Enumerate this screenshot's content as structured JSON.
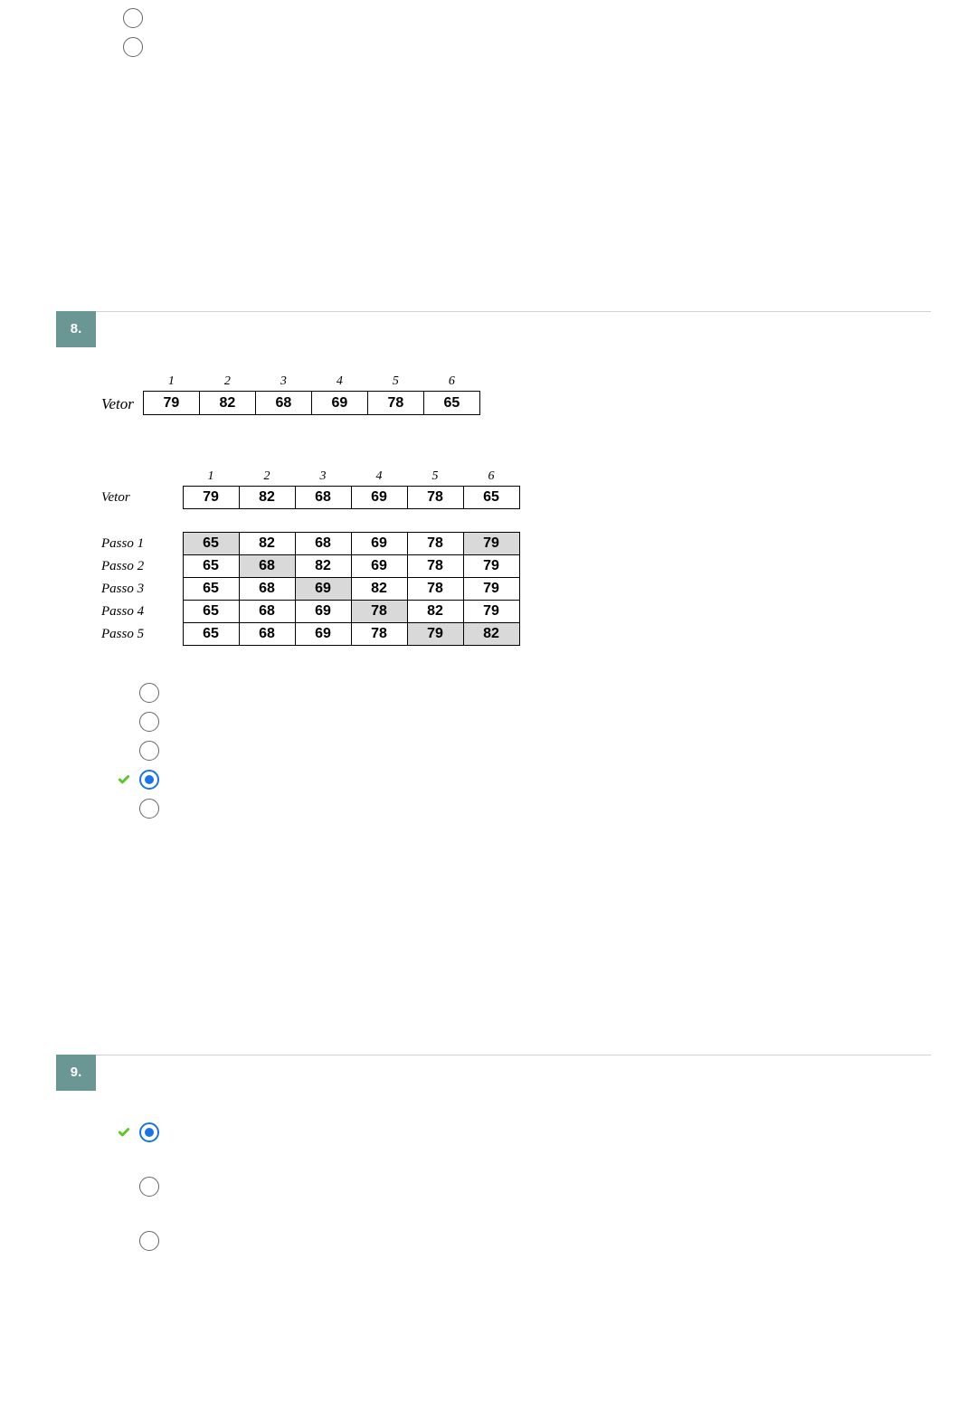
{
  "pre_options_count": 2,
  "q8": {
    "number": "8.",
    "vetor_label": "Vetor",
    "indices": [
      "1",
      "2",
      "3",
      "4",
      "5",
      "6"
    ],
    "vetor_values": [
      "79",
      "82",
      "68",
      "69",
      "78",
      "65"
    ],
    "steps_vetor_label": "Vetor",
    "steps_vetor_values": [
      "79",
      "82",
      "68",
      "69",
      "78",
      "65"
    ],
    "step_rows": [
      {
        "label": "Passo 1",
        "cells": [
          "65",
          "82",
          "68",
          "69",
          "78",
          "79"
        ],
        "hl": [
          0,
          5
        ]
      },
      {
        "label": "Passo 2",
        "cells": [
          "65",
          "68",
          "82",
          "69",
          "78",
          "79"
        ],
        "hl": [
          1
        ]
      },
      {
        "label": "Passo 3",
        "cells": [
          "65",
          "68",
          "69",
          "82",
          "78",
          "79"
        ],
        "hl": [
          2
        ]
      },
      {
        "label": "Passo 4",
        "cells": [
          "65",
          "68",
          "69",
          "78",
          "82",
          "79"
        ],
        "hl": [
          3
        ]
      },
      {
        "label": "Passo 5",
        "cells": [
          "65",
          "68",
          "69",
          "78",
          "79",
          "82"
        ],
        "hl": [
          4,
          5
        ]
      }
    ],
    "option_count": 5,
    "selected_index": 3,
    "correct_index": 3
  },
  "q9": {
    "number": "9.",
    "option_count": 3,
    "selected_index": 0,
    "correct_index": 0
  }
}
